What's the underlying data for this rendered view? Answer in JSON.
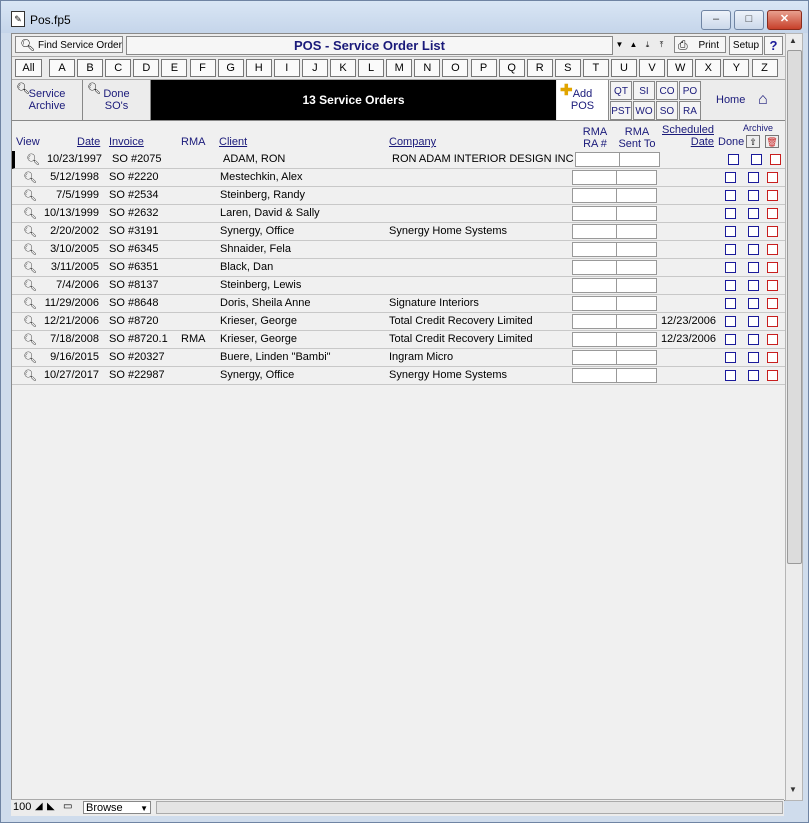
{
  "window": {
    "title": "Pos.fp5"
  },
  "toolbar": {
    "find_label": "Find Service Order",
    "layout_title": "POS - Service Order List",
    "print_label": "Print",
    "setup_label": "Setup",
    "help_label": "?"
  },
  "alphabet": [
    "All",
    "A",
    "B",
    "C",
    "D",
    "E",
    "F",
    "G",
    "H",
    "I",
    "J",
    "K",
    "L",
    "M",
    "N",
    "O",
    "P",
    "Q",
    "R",
    "S",
    "T",
    "U",
    "V",
    "W",
    "X",
    "Y",
    "Z"
  ],
  "nav": {
    "service_archive_1": "Service",
    "service_archive_2": "Archive",
    "done_sos_1": "Done",
    "done_sos_2": "SO's",
    "record_count": "13 Service Orders",
    "add_pos_1": "Add",
    "add_pos_2": "POS",
    "shortcuts_top": [
      "QT",
      "SI",
      "CO",
      "PO"
    ],
    "shortcuts_bottom": [
      "PST",
      "WO",
      "SO",
      "RA"
    ],
    "home_label": "Home"
  },
  "columns": {
    "view": "View",
    "date": "Date",
    "invoice": "Invoice",
    "rma": "RMA",
    "client": "Client",
    "company": "Company",
    "rma_ra_1": "RMA",
    "rma_ra_2": "RA #",
    "rma_sent_1": "RMA",
    "rma_sent_2": "Sent To",
    "scheduled_1": "Scheduled",
    "scheduled_2": "Date",
    "done": "Done",
    "archive": "Archive"
  },
  "rows": [
    {
      "date": "10/23/1997",
      "invoice": "SO #2075",
      "rma": "",
      "client": "ADAM, RON",
      "company": "RON ADAM INTERIOR DESIGN INC.",
      "scheduled": ""
    },
    {
      "date": "5/12/1998",
      "invoice": "SO #2220",
      "rma": "",
      "client": "Mestechkin, Alex",
      "company": "",
      "scheduled": ""
    },
    {
      "date": "7/5/1999",
      "invoice": "SO #2534",
      "rma": "",
      "client": "Steinberg, Randy",
      "company": "",
      "scheduled": ""
    },
    {
      "date": "10/13/1999",
      "invoice": "SO #2632",
      "rma": "",
      "client": "Laren, David & Sally",
      "company": "",
      "scheduled": ""
    },
    {
      "date": "2/20/2002",
      "invoice": "SO #3191",
      "rma": "",
      "client": "Synergy, Office",
      "company": "Synergy Home Systems",
      "scheduled": ""
    },
    {
      "date": "3/10/2005",
      "invoice": "SO #6345",
      "rma": "",
      "client": "Shnaider, Fela",
      "company": "",
      "scheduled": ""
    },
    {
      "date": "3/11/2005",
      "invoice": "SO #6351",
      "rma": "",
      "client": "Black, Dan",
      "company": "",
      "scheduled": ""
    },
    {
      "date": "7/4/2006",
      "invoice": "SO #8137",
      "rma": "",
      "client": "Steinberg, Lewis",
      "company": "",
      "scheduled": ""
    },
    {
      "date": "11/29/2006",
      "invoice": "SO #8648",
      "rma": "",
      "client": "Doris, Sheila Anne",
      "company": "Signature Interiors",
      "scheduled": ""
    },
    {
      "date": "12/21/2006",
      "invoice": "SO #8720",
      "rma": "",
      "client": "Krieser, George",
      "company": "Total Credit Recovery Limited",
      "scheduled": "12/23/2006"
    },
    {
      "date": "7/18/2008",
      "invoice": "SO #8720.1",
      "rma": "RMA",
      "client": "Krieser, George",
      "company": "Total Credit Recovery Limited",
      "scheduled": "12/23/2006"
    },
    {
      "date": "9/16/2015",
      "invoice": "SO #20327",
      "rma": "",
      "client": "Buere, Linden \"Bambi\"",
      "company": "Ingram Micro",
      "scheduled": ""
    },
    {
      "date": "10/27/2017",
      "invoice": "SO #22987",
      "rma": "",
      "client": "Synergy, Office",
      "company": "Synergy Home Systems",
      "scheduled": ""
    }
  ],
  "status": {
    "zoom": "100",
    "mode": "Browse"
  }
}
